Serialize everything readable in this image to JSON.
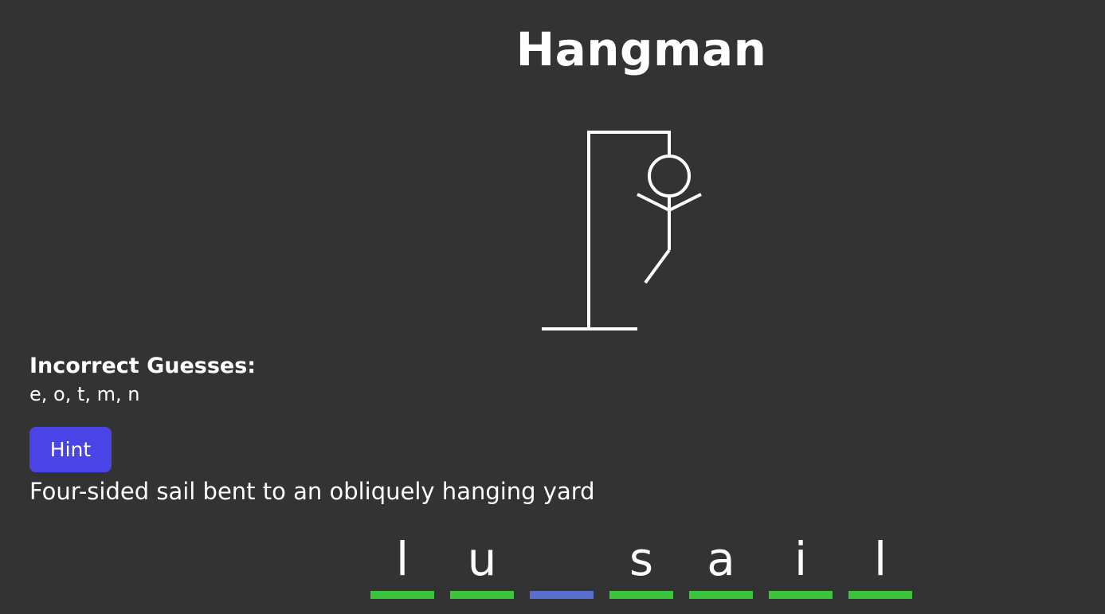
{
  "title": "Hangman",
  "incorrect": {
    "heading": "Incorrect Guesses:",
    "letters": "e, o, t, m, n"
  },
  "hint": {
    "button_label": "Hint",
    "text": "Four-sided sail bent to an obliquely hanging yard"
  },
  "word": {
    "slots": [
      {
        "letter": "l",
        "state": "revealed"
      },
      {
        "letter": "u",
        "state": "revealed"
      },
      {
        "letter": "",
        "state": "hidden"
      },
      {
        "letter": "s",
        "state": "revealed"
      },
      {
        "letter": "a",
        "state": "revealed"
      },
      {
        "letter": "i",
        "state": "revealed"
      },
      {
        "letter": "l",
        "state": "revealed"
      }
    ]
  },
  "colors": {
    "background": "#333333",
    "revealed_bar": "#3dc43d",
    "hidden_bar": "#5a6fcc",
    "hint_button": "#4a44e6",
    "text": "#ffffff"
  }
}
